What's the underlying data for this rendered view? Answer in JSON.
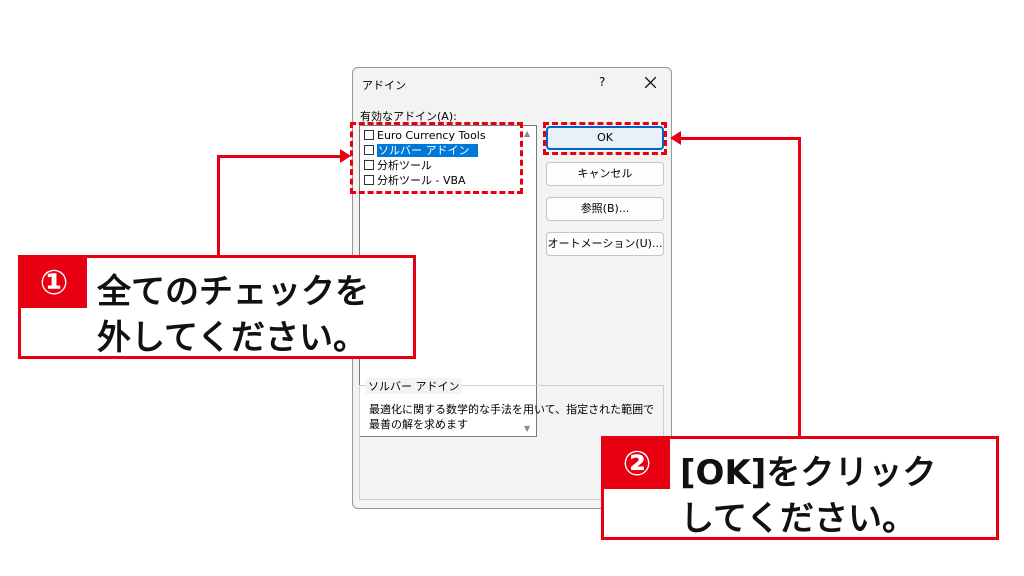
{
  "dialog": {
    "title": "アドイン",
    "help": "?",
    "list_label": "有効なアドイン(A):",
    "addins": [
      {
        "label": "Euro Currency Tools",
        "checked": false,
        "selected": false
      },
      {
        "label": "ソルバー アドイン",
        "checked": false,
        "selected": true
      },
      {
        "label": "分析ツール",
        "checked": false,
        "selected": false
      },
      {
        "label": "分析ツール - VBA",
        "checked": false,
        "selected": false
      }
    ],
    "buttons": {
      "ok": "OK",
      "cancel": "キャンセル",
      "browse": "参照(B)...",
      "automation": "オートメーション(U)..."
    },
    "description": {
      "legend": "ソルバー アドイン",
      "text_line1": "最適化に関する数学的な手法を用いて、指定された範囲で",
      "text_line2": "最善の解を求めます"
    }
  },
  "annotations": {
    "callout1": {
      "number": "①",
      "line1": "全てのチェックを",
      "line2": "外してください。"
    },
    "callout2": {
      "number": "②",
      "line1": "[OK]をクリック",
      "line2": "してください。"
    },
    "accent_color": "#e60012"
  }
}
